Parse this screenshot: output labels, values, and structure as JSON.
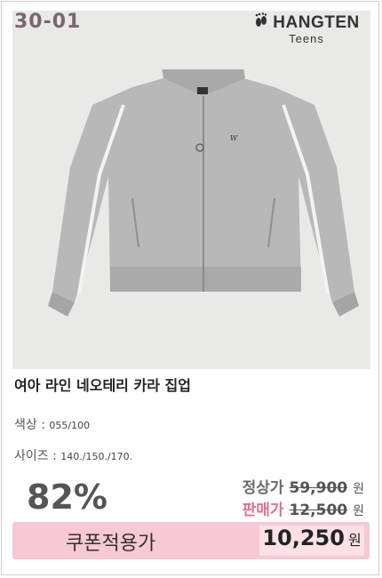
{
  "product_code": "30-01",
  "brand": {
    "name": "HANGTEN",
    "sub": "Teens",
    "logo_icon": "footprint-icon"
  },
  "product": {
    "title": "여아 라인 네오테리 카라 집업",
    "color_label": "색상 :",
    "color_value": "055/100",
    "size_label": "사이즈 :",
    "size_value": "140./150./170."
  },
  "pricing": {
    "discount": "82%",
    "normal_label": "정상가",
    "normal_price": "59,900",
    "sale_label": "판매가",
    "sale_price": "12,500",
    "currency": "원"
  },
  "coupon": {
    "label": "쿠폰적용가",
    "price": "10,250",
    "currency": "원"
  },
  "colors": {
    "accent_pink": "#f6c9d4",
    "sale_label": "#e0708f",
    "code_text": "#7a6670"
  }
}
